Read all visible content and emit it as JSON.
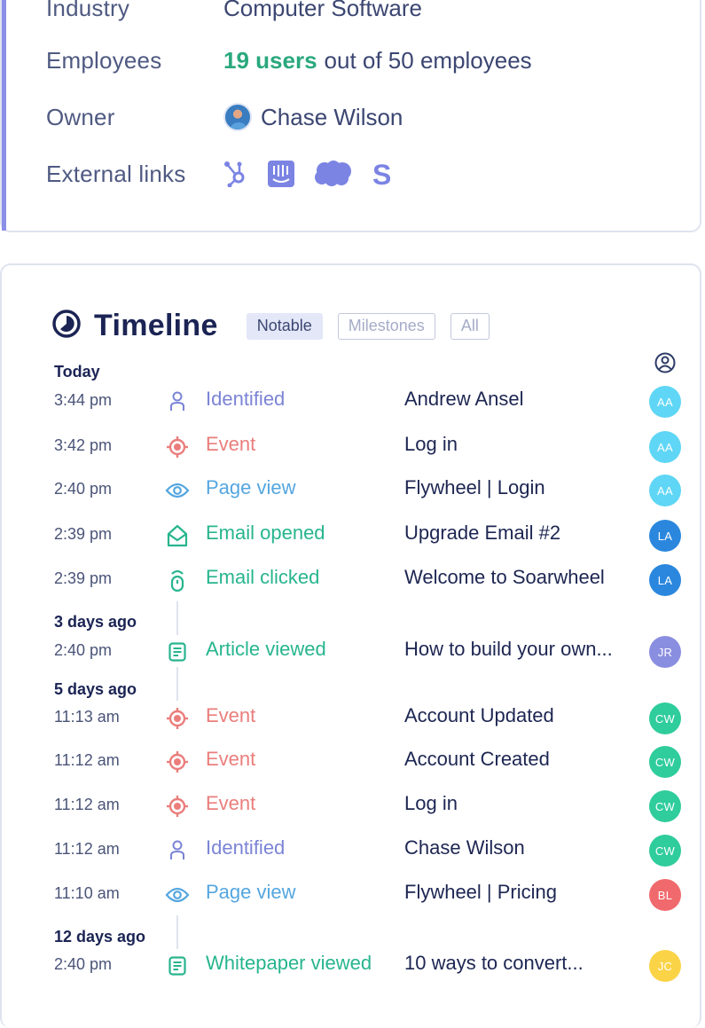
{
  "company_details": {
    "rows": [
      {
        "label": "Industry",
        "value": "Computer Software"
      },
      {
        "label": "Employees",
        "value_highlight": "19 users",
        "value_rest": "out of 50 employees"
      },
      {
        "label": "Owner",
        "value": "Chase Wilson"
      },
      {
        "label": "External links"
      }
    ],
    "external_links": [
      {
        "name": "HubSpot",
        "icon": "hubspot-icon"
      },
      {
        "name": "Intercom",
        "icon": "intercom-icon"
      },
      {
        "name": "Salesforce",
        "icon": "salesforce-icon"
      },
      {
        "name": "Stripe",
        "icon": "stripe-icon"
      }
    ],
    "accent_color": "#8b8fe8"
  },
  "timeline": {
    "title": "Timeline",
    "filters": [
      {
        "label": "Notable",
        "active": true
      },
      {
        "label": "Milestones",
        "active": false
      },
      {
        "label": "All",
        "active": false
      }
    ],
    "user_column_icon": "user-circle-icon",
    "type_colors": {
      "Identified": "#7b84d6",
      "Event": "#ea7e7c",
      "Page view": "#54a6e0",
      "Email opened": "#27b58e",
      "Email clicked": "#27b58e",
      "Article viewed": "#27b58e",
      "Whitepaper viewed": "#27b58e"
    },
    "groups": [
      {
        "label": "Today",
        "events": [
          {
            "time": "3:44 pm",
            "type": "Identified",
            "icon": "person-icon",
            "description": "Andrew Ansel",
            "user": "AA",
            "user_color": "#5fd6f5"
          },
          {
            "time": "3:42 pm",
            "type": "Event",
            "icon": "target-icon",
            "description": "Log in",
            "user": "AA",
            "user_color": "#5fd6f5"
          },
          {
            "time": "2:40 pm",
            "type": "Page view",
            "icon": "eye-icon",
            "description": "Flywheel | Login",
            "user": "AA",
            "user_color": "#5fd6f5"
          },
          {
            "time": "2:39 pm",
            "type": "Email opened",
            "icon": "envelope-open-icon",
            "description": "Upgrade Email #2",
            "user": "LA",
            "user_color": "#2a87dd"
          },
          {
            "time": "2:39 pm",
            "type": "Email clicked",
            "icon": "mouse-click-icon",
            "description": "Welcome to Soarwheel",
            "user": "LA",
            "user_color": "#2a87dd"
          }
        ]
      },
      {
        "label": "3 days ago",
        "events": [
          {
            "time": "2:40 pm",
            "type": "Article viewed",
            "icon": "document-icon",
            "description": "How to build your own...",
            "user": "JR",
            "user_color": "#8a8ee0"
          }
        ]
      },
      {
        "label": "5 days ago",
        "events": [
          {
            "time": "11:13 am",
            "type": "Event",
            "icon": "target-icon",
            "description": "Account Updated",
            "user": "CW",
            "user_color": "#2fcc9c"
          },
          {
            "time": "11:12 am",
            "type": "Event",
            "icon": "target-icon",
            "description": "Account Created",
            "user": "CW",
            "user_color": "#2fcc9c"
          },
          {
            "time": "11:12 am",
            "type": "Event",
            "icon": "target-icon",
            "description": "Log in",
            "user": "CW",
            "user_color": "#2fcc9c"
          },
          {
            "time": "11:12 am",
            "type": "Identified",
            "icon": "person-icon",
            "description": "Chase Wilson",
            "user": "CW",
            "user_color": "#2fcc9c"
          },
          {
            "time": "11:10 am",
            "type": "Page view",
            "icon": "eye-icon",
            "description": "Flywheel | Pricing",
            "user": "BL",
            "user_color": "#f06a6d"
          }
        ]
      },
      {
        "label": "12 days ago",
        "events": [
          {
            "time": "2:40 pm",
            "type": "Whitepaper viewed",
            "icon": "document-icon",
            "description": "10 ways to convert...",
            "user": "JC",
            "user_color": "#fbd347"
          }
        ]
      }
    ]
  }
}
